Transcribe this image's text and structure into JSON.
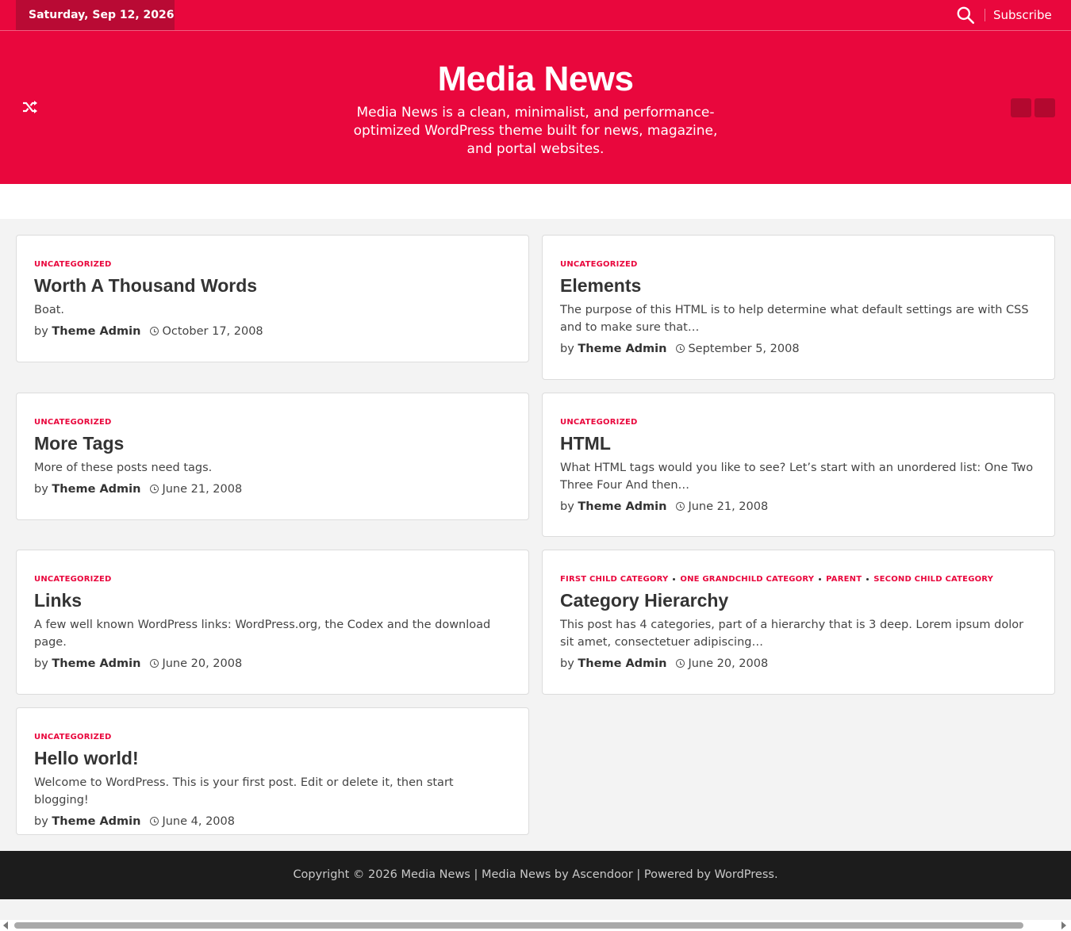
{
  "topbar": {
    "date": "Saturday, Sep 12, 2026",
    "subscribe": "Subscribe",
    "search_icon": "search-icon"
  },
  "header": {
    "title": "Media News",
    "description": "Media News is a clean, minimalist, and performance-optimized WordPress theme built for news, magazine, and portal websites.",
    "shuffle_icon": "shuffle-icon"
  },
  "posts": [
    {
      "categories": [
        "UNCATEGORIZED"
      ],
      "title": "Worth A Thousand Words",
      "excerpt": "Boat.",
      "by": "by",
      "author": "Theme Admin",
      "date": "October 17, 2008"
    },
    {
      "categories": [
        "UNCATEGORIZED"
      ],
      "title": "Elements",
      "excerpt": "The purpose of this HTML is to help determine what default settings are with CSS and to make sure that…",
      "by": "by",
      "author": "Theme Admin",
      "date": "September 5, 2008"
    },
    {
      "categories": [
        "UNCATEGORIZED"
      ],
      "title": "More Tags",
      "excerpt": "More of these posts need tags.",
      "by": "by",
      "author": "Theme Admin",
      "date": "June 21, 2008"
    },
    {
      "categories": [
        "UNCATEGORIZED"
      ],
      "title": "HTML",
      "excerpt": "What HTML tags would you like to see? Let’s start with an unordered list: One Two Three Four And then…",
      "by": "by",
      "author": "Theme Admin",
      "date": "June 21, 2008"
    },
    {
      "categories": [
        "UNCATEGORIZED"
      ],
      "title": "Links",
      "excerpt": "A few well known WordPress links: WordPress.org, the Codex and the download page.",
      "by": "by",
      "author": "Theme Admin",
      "date": "June 20, 2008"
    },
    {
      "categories": [
        "FIRST CHILD CATEGORY",
        "ONE GRANDCHILD CATEGORY",
        "PARENT",
        "SECOND CHILD CATEGORY"
      ],
      "title": "Category Hierarchy",
      "excerpt": "This post has 4 categories, part of a hierarchy that is 3 deep. Lorem ipsum dolor sit amet, consectetuer adipiscing…",
      "by": "by",
      "author": "Theme Admin",
      "date": "June 20, 2008"
    },
    {
      "categories": [
        "UNCATEGORIZED"
      ],
      "title": "Hello world!",
      "excerpt": "Welcome to WordPress. This is your first post. Edit or delete it, then start blogging!",
      "by": "by",
      "author": "Theme Admin",
      "date": "June 4, 2008"
    }
  ],
  "footer": {
    "text": "Copyright © 2026 Media News | Media News by Ascendoor | Powered by WordPress."
  },
  "colors": {
    "brand": "#e9073d",
    "brand_dark": "#b90a34",
    "footer_bg": "#1c1c1c"
  }
}
